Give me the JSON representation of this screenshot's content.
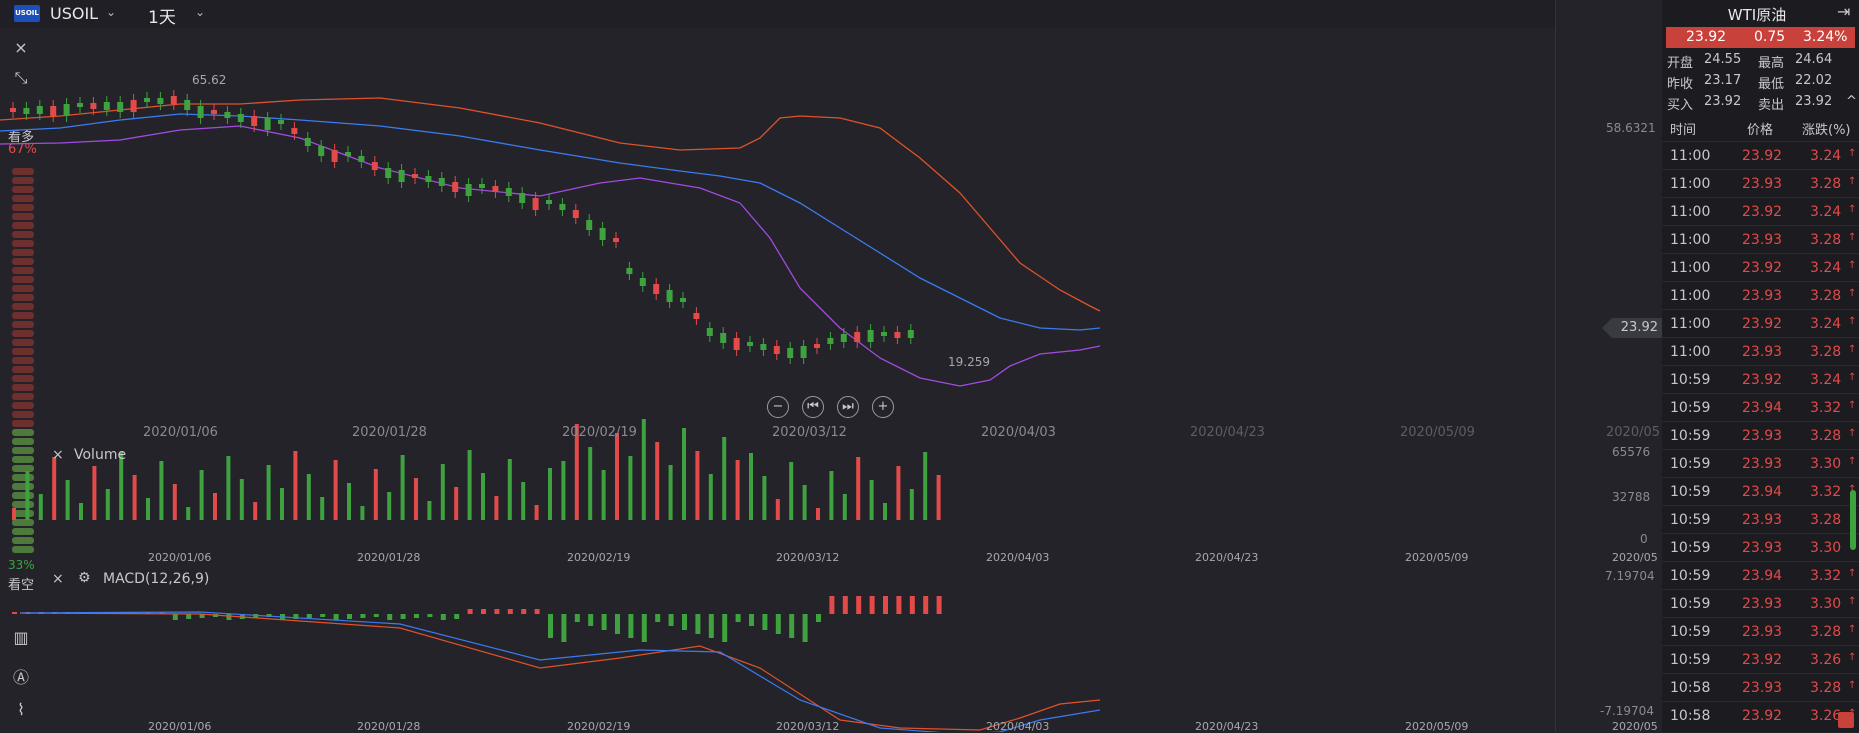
{
  "header": {
    "logo_text": "USOIL",
    "symbol": "USOIL",
    "period": "1天"
  },
  "left_toolbar": {
    "close_glyph": "×",
    "collapse_glyph": "⤡",
    "chart_type_glyph": "▥",
    "draw_glyph": "Ⓐ",
    "indicator_glyph": "⌇"
  },
  "sentiment": {
    "bull_label": "看多",
    "bull_pct": "67%",
    "bear_label": "看空",
    "bear_pct": "33%"
  },
  "price_chart": {
    "high_label": "65.62",
    "low_label": "19.259",
    "axis_top": "58.6321",
    "last_price": "23.92",
    "dates": [
      "2020/01/06",
      "2020/01/28",
      "2020/02/19",
      "2020/03/12",
      "2020/04/03",
      "2020/04/23",
      "2020/05/09"
    ],
    "edge_date": "2020/05",
    "controls": [
      "−",
      "⏮",
      "⏭",
      "+"
    ]
  },
  "volume_panel": {
    "title": "Volume",
    "close_glyph": "×",
    "scale_top": "65576",
    "scale_mid": "32788",
    "scale_bot": "0",
    "dates": [
      "2020/01/06",
      "2020/01/28",
      "2020/02/19",
      "2020/03/12",
      "2020/04/03",
      "2020/04/23",
      "2020/05/09"
    ],
    "edge_date": "2020/05"
  },
  "macd_panel": {
    "title": "MACD(12,26,9)",
    "close_glyph": "×",
    "settings_glyph": "⚙",
    "scale_top": "7.19704",
    "scale_bot": "-7.19704",
    "dates": [
      "2020/01/06",
      "2020/01/28",
      "2020/02/19",
      "2020/03/12",
      "2020/04/03",
      "2020/04/23",
      "2020/05/09"
    ],
    "edge_date": "2020/05"
  },
  "quote_panel": {
    "title": "WTI原油",
    "exit_glyph": "⇥",
    "price": "23.92",
    "change": "0.75",
    "change_pct": "3.24%",
    "open_label": "开盘",
    "open": "24.55",
    "high_label": "最高",
    "high": "24.64",
    "prev_close_label": "昨收",
    "prev_close": "23.17",
    "low_label": "最低",
    "low": "22.02",
    "bid_label": "买入",
    "bid": "23.92",
    "ask_label": "卖出",
    "ask": "23.92",
    "collapse_glyph": "^",
    "col_time": "时间",
    "col_price": "价格",
    "col_change": "涨跌(%)",
    "trades": [
      {
        "time": "11:00",
        "price": "23.92",
        "change": "3.24"
      },
      {
        "time": "11:00",
        "price": "23.93",
        "change": "3.28"
      },
      {
        "time": "11:00",
        "price": "23.92",
        "change": "3.24"
      },
      {
        "time": "11:00",
        "price": "23.93",
        "change": "3.28"
      },
      {
        "time": "11:00",
        "price": "23.92",
        "change": "3.24"
      },
      {
        "time": "11:00",
        "price": "23.93",
        "change": "3.28"
      },
      {
        "time": "11:00",
        "price": "23.92",
        "change": "3.24"
      },
      {
        "time": "11:00",
        "price": "23.93",
        "change": "3.28"
      },
      {
        "time": "10:59",
        "price": "23.92",
        "change": "3.24"
      },
      {
        "time": "10:59",
        "price": "23.94",
        "change": "3.32"
      },
      {
        "time": "10:59",
        "price": "23.93",
        "change": "3.28"
      },
      {
        "time": "10:59",
        "price": "23.93",
        "change": "3.30"
      },
      {
        "time": "10:59",
        "price": "23.94",
        "change": "3.32"
      },
      {
        "time": "10:59",
        "price": "23.93",
        "change": "3.28"
      },
      {
        "time": "10:59",
        "price": "23.93",
        "change": "3.30"
      },
      {
        "time": "10:59",
        "price": "23.94",
        "change": "3.32"
      },
      {
        "time": "10:59",
        "price": "23.93",
        "change": "3.30"
      },
      {
        "time": "10:59",
        "price": "23.93",
        "change": "3.28"
      },
      {
        "time": "10:59",
        "price": "23.92",
        "change": "3.26"
      },
      {
        "time": "10:58",
        "price": "23.93",
        "change": "3.28"
      },
      {
        "time": "10:58",
        "price": "23.92",
        "change": "3.26"
      }
    ]
  },
  "colors": {
    "up": "#e34a4a",
    "down": "#3ea33e",
    "ma": "#3b7bf0",
    "upper_band": "#e0522a",
    "lower_band": "#a34be0"
  }
}
